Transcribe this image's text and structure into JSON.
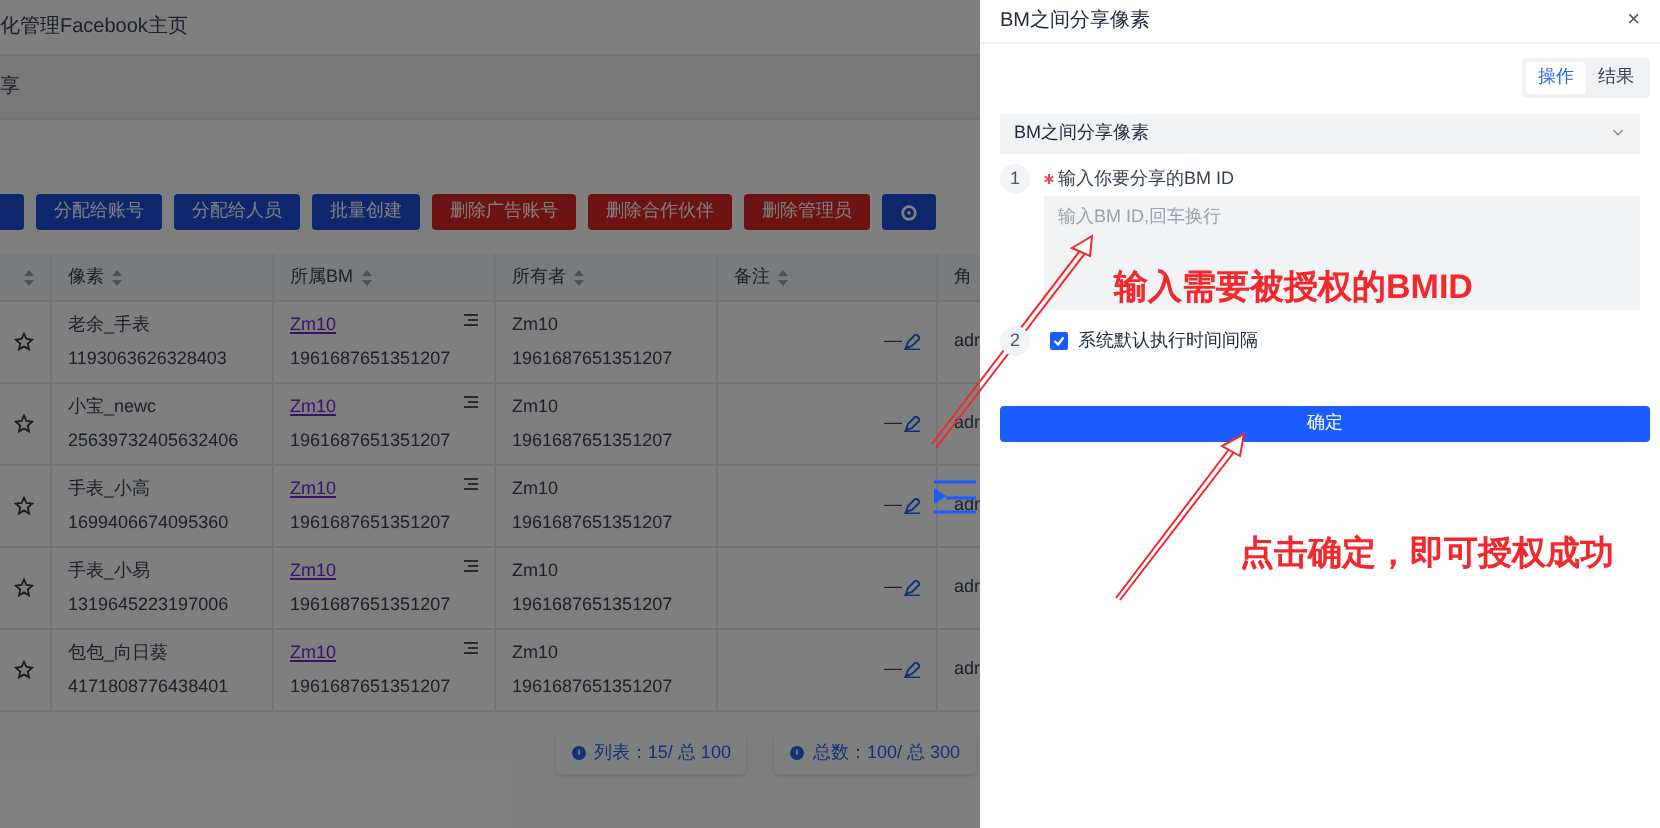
{
  "page": {
    "title": "化管理Facebook主页",
    "tab": "享",
    "buttons": [
      {
        "kind": "primary"
      },
      {
        "label": "分配给账号",
        "kind": "primary"
      },
      {
        "label": "分配给人员",
        "kind": "primary"
      },
      {
        "label": "批量创建",
        "kind": "primary"
      },
      {
        "label": "删除广告账号",
        "kind": "danger"
      },
      {
        "label": "删除合作伙伴",
        "kind": "danger"
      },
      {
        "label": "删除管理员",
        "kind": "danger"
      },
      {
        "kind": "gear"
      }
    ],
    "table": {
      "columns": [
        null,
        "像素",
        "所属BM",
        "所有者",
        "备注",
        "角"
      ],
      "rows": [
        {
          "name": "老余_手表",
          "id": "1193063626328403",
          "bm": "Zm10",
          "bm_id": "1961687651351207",
          "owner": "Zm10",
          "owner_id": "1961687651351207",
          "note": "—",
          "role": "adr"
        },
        {
          "name": "小宝_newc",
          "id": "25639732405632406",
          "bm": "Zm10",
          "bm_id": "1961687651351207",
          "owner": "Zm10",
          "owner_id": "1961687651351207",
          "note": "—",
          "role": "adr"
        },
        {
          "name": "手表_小高",
          "id": "1699406674095360",
          "bm": "Zm10",
          "bm_id": "1961687651351207",
          "owner": "Zm10",
          "owner_id": "1961687651351207",
          "note": "—",
          "role": "adr"
        },
        {
          "name": "手表_小易",
          "id": "1319645223197006",
          "bm": "Zm10",
          "bm_id": "1961687651351207",
          "owner": "Zm10",
          "owner_id": "1961687651351207",
          "note": "—",
          "role": "adr"
        },
        {
          "name": "包包_向日葵",
          "id": "4171808776438401",
          "bm": "Zm10",
          "bm_id": "1961687651351207",
          "owner": "Zm10",
          "owner_id": "1961687651351207",
          "note": "—",
          "role": "adr"
        }
      ]
    },
    "stats": [
      "列表：15/ 总 100",
      "总数：100/ 总 300"
    ]
  },
  "drawer": {
    "title": "BM之间分享像素",
    "close": "×",
    "tabs": [
      {
        "label": "操作",
        "selected": true
      },
      {
        "label": "结果",
        "selected": false
      }
    ],
    "section": {
      "title": "BM之间分享像素",
      "expanded": true
    },
    "steps": [
      {
        "number": "1",
        "kind": "textarea",
        "required": true,
        "label": "输入你要分享的BM ID",
        "placeholder": "输入BM ID,回车换行"
      },
      {
        "number": "2",
        "kind": "checkbox",
        "checked": true,
        "label": "系统默认执行时间间隔"
      }
    ],
    "confirm": "确定"
  },
  "annotations": [
    "输入需要被授权的BMID",
    "点击确定，即可授权成功"
  ]
}
